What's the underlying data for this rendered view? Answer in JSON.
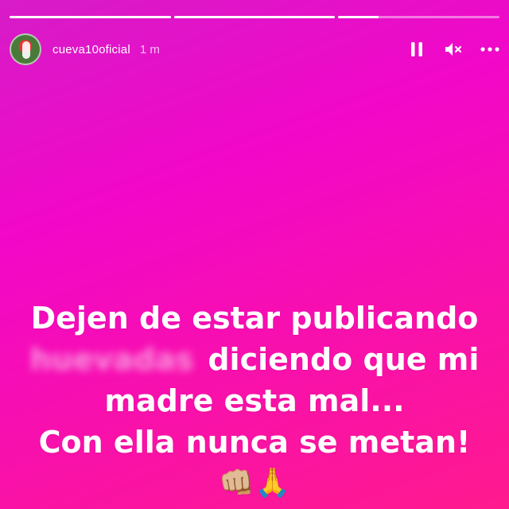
{
  "progress": [
    {
      "fill": 1.0
    },
    {
      "fill": 1.0
    },
    {
      "fill": 0.25
    }
  ],
  "header": {
    "username": "cueva10oficial",
    "time": "1 m",
    "pause_icon": "pause-icon",
    "mute_icon": "speaker-muted-icon",
    "more_icon": "more-options-icon"
  },
  "caption": {
    "line1": "Dejen de estar publicando",
    "blurred_word": "huevadas",
    "line2_rest": "diciendo que mi",
    "line3": "madre esta mal...",
    "line4": "Con ella nunca se metan!",
    "emojis": "👊🏼🙏"
  }
}
